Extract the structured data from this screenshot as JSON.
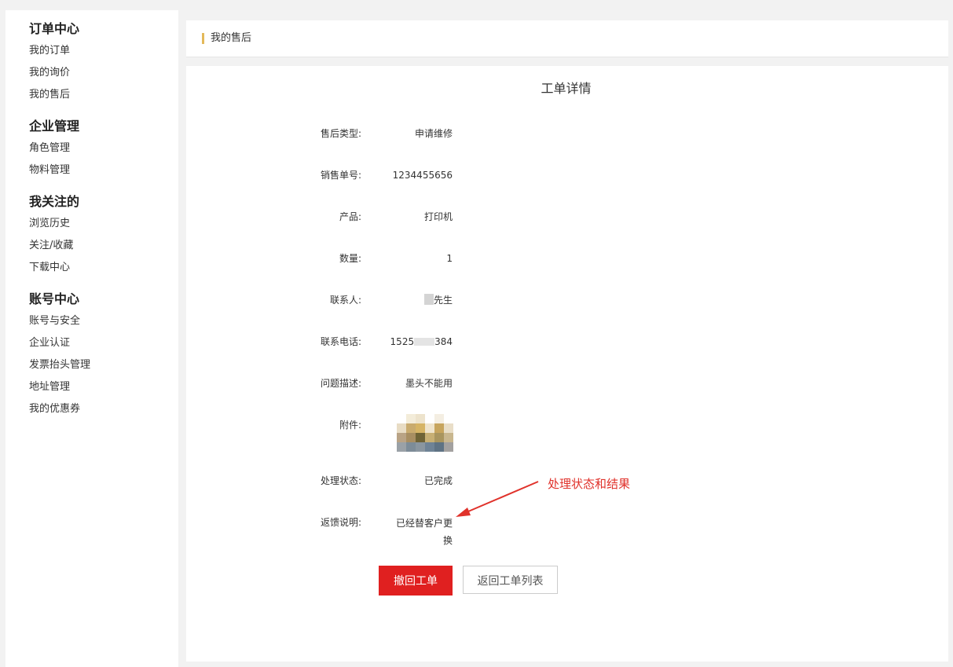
{
  "sidebar": {
    "groups": [
      {
        "title": "订单中心",
        "items": [
          "我的订单",
          "我的询价",
          "我的售后"
        ]
      },
      {
        "title": "企业管理",
        "items": [
          "角色管理",
          "物料管理"
        ]
      },
      {
        "title": "我关注的",
        "items": [
          "浏览历史",
          "关注/收藏",
          "下载中心"
        ]
      },
      {
        "title": "账号中心",
        "items": [
          "账号与安全",
          "企业认证",
          "发票抬头管理",
          "地址管理",
          "我的优惠券"
        ]
      }
    ]
  },
  "breadcrumb": {
    "current": "我的售后"
  },
  "detail": {
    "title": "工单详情",
    "fields": [
      {
        "label": "售后类型:",
        "value": "申请维修"
      },
      {
        "label": "销售单号:",
        "value": "1234455656"
      },
      {
        "label": "产品:",
        "value": "打印机"
      },
      {
        "label": "数量:",
        "value": "1"
      },
      {
        "label": "联系人:",
        "value": "先生"
      },
      {
        "label": "联系电话:",
        "value_prefix": "1525",
        "value_suffix": "384"
      },
      {
        "label": "问题描述:",
        "value": "墨头不能用"
      },
      {
        "label": "附件:"
      },
      {
        "label": "处理状态:",
        "value": "已完成"
      },
      {
        "label": "返馈说明:",
        "value_line1": "已经替客户更",
        "value_line2": "换"
      }
    ]
  },
  "actions": {
    "withdraw_label": "撤回工单",
    "back_label": "返回工单列表"
  },
  "annotation": {
    "text": "处理状态和结果",
    "color": "#e0322b"
  },
  "colors": {
    "primary": "#e02020",
    "accent_marker": "#e3b95a",
    "background": "#f2f2f2"
  }
}
